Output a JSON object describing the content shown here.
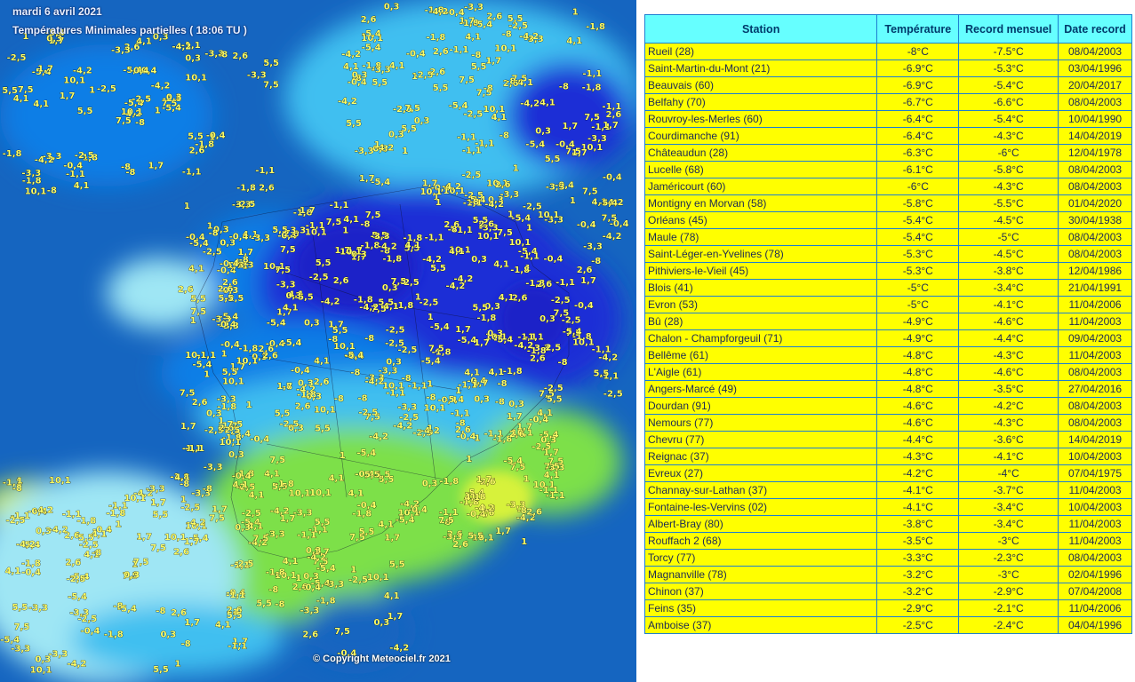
{
  "map": {
    "date": "mardi 6 avril 2021",
    "subtitle": "Températures Minimales partielles ( 18:06 TU )",
    "copyright": "© Copyright Meteociel.fr 2021",
    "colors": {
      "sea": "#1565c0",
      "very_cold": "#1a2fd6",
      "cold": "#0a7ee6",
      "cool": "#40bff0",
      "mild": "#9fe6f4",
      "warm": "#7de04a",
      "hot": "#d7f23a"
    },
    "values": [
      "-8",
      "-6,9",
      "-6,6",
      "-6,3",
      "-5,9",
      "-5,6",
      "-5,5",
      "-5,4",
      "-5,3",
      "-5",
      "-4,9",
      "-4,8",
      "-4,6",
      "-4,5",
      "-4,2",
      "-4,1",
      "-3,9",
      "-3,7",
      "-3,6",
      "-3,5",
      "-3,4",
      "-3,3",
      "-3,2",
      "-3,1",
      "-3",
      "-2,9",
      "-2,8",
      "-2,7",
      "-2,5",
      "-2,4",
      "-2,3",
      "-2,2",
      "-2,1",
      "-2",
      "-1,9",
      "-1,8",
      "-1,7",
      "-1,6",
      "-1,5",
      "-1,4",
      "-1,3",
      "-1,2",
      "-1,1",
      "-1",
      "-0,9",
      "-0,8",
      "-0,7",
      "-0,6",
      "-0,5",
      "-0,4",
      "-0,3",
      "-0,2",
      "-0,1",
      "0",
      "0,1",
      "0,2",
      "0,3",
      "0,4",
      "0,5",
      "0,6",
      "0,7",
      "0,8",
      "0,9",
      "1",
      "1,1",
      "1,2",
      "1,3",
      "1,4",
      "1,5",
      "1,6",
      "1,7",
      "1,8",
      "1,9",
      "2",
      "2,1",
      "2,2",
      "2,4",
      "2,6",
      "2,8",
      "2,9",
      "3,2",
      "3,3",
      "3,5",
      "3,7",
      "4,1",
      "4,2",
      "4,3",
      "4,6",
      "4,8",
      "5,2",
      "5,3",
      "5,5",
      "5,7",
      "6",
      "6,2",
      "6,5",
      "6,8",
      "7",
      "7,5",
      "7,8",
      "7,9",
      "8,2",
      "8,4",
      "8,9",
      "9,2",
      "10,1",
      "10,3",
      "10,6",
      "10,7",
      "11,5",
      "12,2",
      "13,1"
    ]
  },
  "table": {
    "headers": {
      "station": "Station",
      "temperature": "Température",
      "record": "Record mensuel",
      "date": "Date record"
    },
    "rows": [
      {
        "station": "Rueil (28)",
        "temp": "-8°C",
        "record": "-7.5°C",
        "date": "08/04/2003"
      },
      {
        "station": "Saint-Martin-du-Mont (21)",
        "temp": "-6.9°C",
        "record": "-5.3°C",
        "date": "03/04/1996"
      },
      {
        "station": "Beauvais (60)",
        "temp": "-6.9°C",
        "record": "-5.4°C",
        "date": "20/04/2017"
      },
      {
        "station": "Belfahy (70)",
        "temp": "-6.7°C",
        "record": "-6.6°C",
        "date": "08/04/2003"
      },
      {
        "station": "Rouvroy-les-Merles (60)",
        "temp": "-6.4°C",
        "record": "-5.4°C",
        "date": "10/04/1990"
      },
      {
        "station": "Courdimanche (91)",
        "temp": "-6.4°C",
        "record": "-4.3°C",
        "date": "14/04/2019"
      },
      {
        "station": "Châteaudun (28)",
        "temp": "-6.3°C",
        "record": "-6°C",
        "date": "12/04/1978"
      },
      {
        "station": "Lucelle (68)",
        "temp": "-6.1°C",
        "record": "-5.8°C",
        "date": "08/04/2003"
      },
      {
        "station": "Jaméricourt (60)",
        "temp": "-6°C",
        "record": "-4.3°C",
        "date": "08/04/2003"
      },
      {
        "station": "Montigny en Morvan (58)",
        "temp": "-5.8°C",
        "record": "-5.5°C",
        "date": "01/04/2020"
      },
      {
        "station": "Orléans (45)",
        "temp": "-5.4°C",
        "record": "-4.5°C",
        "date": "30/04/1938"
      },
      {
        "station": "Maule (78)",
        "temp": "-5.4°C",
        "record": "-5°C",
        "date": "08/04/2003"
      },
      {
        "station": "Saint-Léger-en-Yvelines (78)",
        "temp": "-5.3°C",
        "record": "-4.5°C",
        "date": "08/04/2003"
      },
      {
        "station": "Pithiviers-le-Vieil (45)",
        "temp": "-5.3°C",
        "record": "-3.8°C",
        "date": "12/04/1986"
      },
      {
        "station": "Blois (41)",
        "temp": "-5°C",
        "record": "-3.4°C",
        "date": "21/04/1991"
      },
      {
        "station": "Evron (53)",
        "temp": "-5°C",
        "record": "-4.1°C",
        "date": "11/04/2006"
      },
      {
        "station": "Bû (28)",
        "temp": "-4.9°C",
        "record": "-4.6°C",
        "date": "11/04/2003"
      },
      {
        "station": "Chalon - Champforgeuil (71)",
        "temp": "-4.9°C",
        "record": "-4.4°C",
        "date": "09/04/2003"
      },
      {
        "station": "Bellême (61)",
        "temp": "-4.8°C",
        "record": "-4.3°C",
        "date": "11/04/2003"
      },
      {
        "station": "L'Aigle (61)",
        "temp": "-4.8°C",
        "record": "-4.6°C",
        "date": "08/04/2003"
      },
      {
        "station": "Angers-Marcé (49)",
        "temp": "-4.8°C",
        "record": "-3.5°C",
        "date": "27/04/2016"
      },
      {
        "station": "Dourdan (91)",
        "temp": "-4.6°C",
        "record": "-4.2°C",
        "date": "08/04/2003"
      },
      {
        "station": "Nemours (77)",
        "temp": "-4.6°C",
        "record": "-4.3°C",
        "date": "08/04/2003"
      },
      {
        "station": "Chevru (77)",
        "temp": "-4.4°C",
        "record": "-3.6°C",
        "date": "14/04/2019"
      },
      {
        "station": "Reignac (37)",
        "temp": "-4.3°C",
        "record": "-4.1°C",
        "date": "10/04/2003"
      },
      {
        "station": "Evreux (27)",
        "temp": "-4.2°C",
        "record": "-4°C",
        "date": "07/04/1975"
      },
      {
        "station": "Channay-sur-Lathan (37)",
        "temp": "-4.1°C",
        "record": "-3.7°C",
        "date": "11/04/2003"
      },
      {
        "station": "Fontaine-les-Vervins (02)",
        "temp": "-4.1°C",
        "record": "-3.4°C",
        "date": "10/04/2003"
      },
      {
        "station": "Albert-Bray (80)",
        "temp": "-3.8°C",
        "record": "-3.4°C",
        "date": "11/04/2003"
      },
      {
        "station": "Rouffach 2 (68)",
        "temp": "-3.5°C",
        "record": "-3°C",
        "date": "11/04/2003"
      },
      {
        "station": "Torcy (77)",
        "temp": "-3.3°C",
        "record": "-2.3°C",
        "date": "08/04/2003"
      },
      {
        "station": "Magnanville (78)",
        "temp": "-3.2°C",
        "record": "-3°C",
        "date": "02/04/1996"
      },
      {
        "station": "Chinon (37)",
        "temp": "-3.2°C",
        "record": "-2.9°C",
        "date": "07/04/2008"
      },
      {
        "station": "Feins (35)",
        "temp": "-2.9°C",
        "record": "-2.1°C",
        "date": "11/04/2006"
      },
      {
        "station": "Amboise (37)",
        "temp": "-2.5°C",
        "record": "-2.4°C",
        "date": "04/04/1996"
      }
    ]
  }
}
